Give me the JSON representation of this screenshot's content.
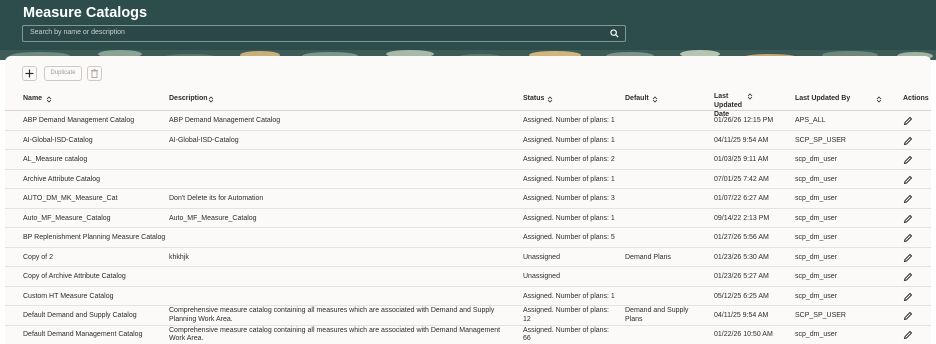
{
  "page": {
    "title": "Measure Catalogs"
  },
  "search": {
    "placeholder": "Search by name or description"
  },
  "toolbar": {
    "duplicate_label": "Duplicate"
  },
  "table": {
    "headers": {
      "name": "Name",
      "description": "Description",
      "status": "Status",
      "default": "Default",
      "last_updated_date": "Last Updated Date",
      "last_updated_by": "Last Updated By",
      "actions": "Actions"
    },
    "rows": [
      {
        "name": "ABP Demand Management Catalog",
        "description": "ABP Demand Management Catalog",
        "status": "Assigned. Number of plans: 1",
        "default": "",
        "date": "01/26/26 12:15 PM",
        "by": "APS_ALL"
      },
      {
        "name": "AI-Global-ISD-Catalog",
        "description": "AI-Global-ISD-Catalog",
        "status": "Assigned. Number of plans: 1",
        "default": "",
        "date": "04/11/25 9:54 AM",
        "by": "SCP_SP_USER"
      },
      {
        "name": "AL_Measure catalog",
        "description": "",
        "status": "Assigned. Number of plans: 2",
        "default": "",
        "date": "01/03/25 9:11 AM",
        "by": "scp_dm_user"
      },
      {
        "name": "Archive Attribute Catalog",
        "description": "",
        "status": "Assigned. Number of plans: 1",
        "default": "",
        "date": "07/01/25 7:42 AM",
        "by": "scp_dm_user"
      },
      {
        "name": "AUTO_DM_MK_Measure_Cat",
        "description": "Don't Delete its for Automation",
        "status": "Assigned. Number of plans: 3",
        "default": "",
        "date": "01/07/22 6:27 AM",
        "by": "scp_dm_user"
      },
      {
        "name": "Auto_MF_Measure_Catalog",
        "description": "Auto_MF_Measure_Catalog",
        "status": "Assigned. Number of plans: 1",
        "default": "",
        "date": "09/14/22 2:13 PM",
        "by": "scp_dm_user"
      },
      {
        "name": "BP Replenishment Planning Measure Catalog",
        "description": "",
        "status": "Assigned. Number of plans: 5",
        "default": "",
        "date": "01/27/26 5:56 AM",
        "by": "scp_dm_user"
      },
      {
        "name": "Copy of 2",
        "description": "khkhjk",
        "status": "Unassigned",
        "default": "Demand Plans",
        "date": "01/23/26 5:30 AM",
        "by": "scp_dm_user"
      },
      {
        "name": "Copy of Archive Attribute Catalog",
        "description": "",
        "status": "Unassigned",
        "default": "",
        "date": "01/23/26 5:27 AM",
        "by": "scp_dm_user"
      },
      {
        "name": "Custom HT Measure Catalog",
        "description": "",
        "status": "Assigned. Number of plans: 1",
        "default": "",
        "date": "05/12/25 6:25 AM",
        "by": "scp_dm_user"
      },
      {
        "name": "Default Demand and Supply Catalog",
        "description": "Comprehensive measure catalog containing all measures which are associated with Demand and Supply Planning Work Area.",
        "status": "Assigned. Number of plans: 12",
        "default": "Demand and Supply Plans",
        "date": "04/11/25 9:54 AM",
        "by": "SCP_SP_USER"
      },
      {
        "name": "Default Demand Management Catalog",
        "description": "Comprehensive measure catalog containing all measures which are associated with Demand Management Work Area.",
        "status": "Assigned. Number of plans: 66",
        "default": "",
        "date": "01/22/26 10:50 AM",
        "by": "scp_dm_user"
      }
    ]
  },
  "icons": {
    "search": "search-icon",
    "add": "plus-icon",
    "delete": "trash-icon",
    "sort": "sort-icon",
    "edit": "pencil-icon"
  },
  "colors": {
    "header_bg": "#2d4d4d",
    "content_bg": "#fbfaf9",
    "text": "#2e2c2a"
  }
}
